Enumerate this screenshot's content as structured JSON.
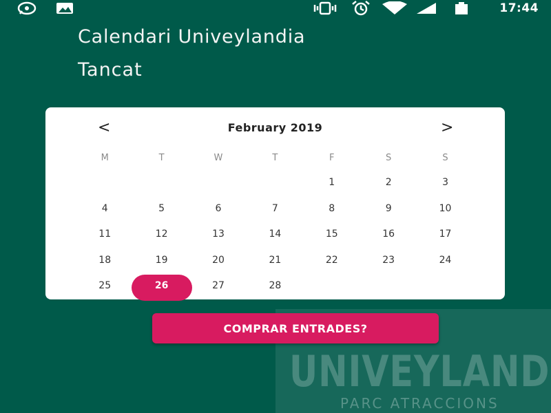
{
  "status_bar": {
    "time": "17:44",
    "left_icons": [
      "whatsapp-icon",
      "image-notification-icon"
    ],
    "right_icons": [
      "vibrate-icon",
      "alarm-icon",
      "wifi-icon",
      "signal-icon",
      "battery-icon"
    ]
  },
  "header": {
    "title": "Calendari Univeylandia",
    "status": "Tancat"
  },
  "calendar": {
    "month_label": "February 2019",
    "prev_arrow": "<",
    "next_arrow": ">",
    "weekdays": [
      "M",
      "T",
      "W",
      "T",
      "F",
      "S",
      "S"
    ],
    "days": [
      "",
      "",
      "",
      "",
      "1",
      "2",
      "3",
      "4",
      "5",
      "6",
      "7",
      "8",
      "9",
      "10",
      "11",
      "12",
      "13",
      "14",
      "15",
      "16",
      "17",
      "18",
      "19",
      "20",
      "21",
      "22",
      "23",
      "24",
      "25",
      "26",
      "27",
      "28",
      "",
      "",
      ""
    ],
    "selected_day": "26"
  },
  "actions": {
    "buy_label": "COMPRAR ENTRADES?"
  },
  "watermark": {
    "name": "UNIVEYLANDIA",
    "subtitle": "PARC ATRACCIONS"
  },
  "colors": {
    "background": "#005a4a",
    "accent": "#d81b60",
    "card": "#ffffff"
  }
}
